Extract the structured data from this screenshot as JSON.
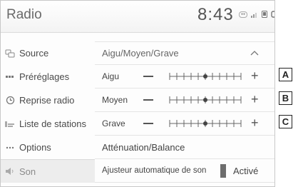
{
  "header": {
    "title": "Radio",
    "time": "8:43"
  },
  "sidebar": {
    "items": [
      {
        "label": "Source",
        "icon": "source-icon",
        "active": false
      },
      {
        "label": "Préréglages",
        "icon": "list-icon",
        "active": false
      },
      {
        "label": "Reprise radio",
        "icon": "replay-icon",
        "active": false
      },
      {
        "label": "Liste de stations",
        "icon": "station-list-icon",
        "active": false
      },
      {
        "label": "Options",
        "icon": "more-icon",
        "active": false
      },
      {
        "label": "Son",
        "icon": "speaker-icon",
        "active": true
      }
    ]
  },
  "content": {
    "section_title": "Aigu/Moyen/Grave",
    "sliders": [
      {
        "label": "Aigu",
        "level": 0
      },
      {
        "label": "Moyen",
        "level": 0
      },
      {
        "label": "Grave",
        "level": 0
      }
    ],
    "attenuation_label": "Atténuation/Balance",
    "auto_sound": {
      "label": "Ajusteur automatique de son",
      "state": "Activé"
    }
  },
  "callouts": [
    "A",
    "B",
    "C"
  ]
}
